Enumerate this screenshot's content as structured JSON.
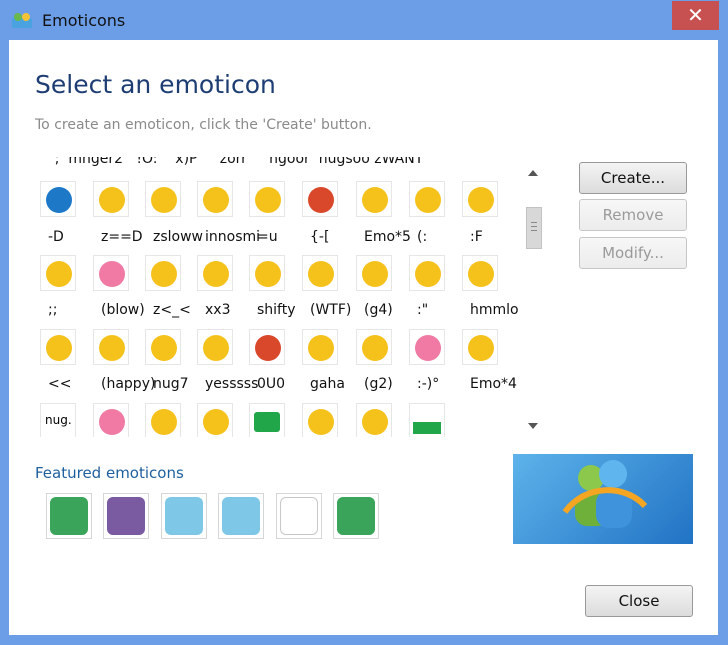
{
  "window": {
    "title": "Emoticons",
    "close_glyph": "✕"
  },
  "header": {
    "heading": "Select an emoticon",
    "subtext": "To create an emoticon, click the 'Create' button."
  },
  "grid": {
    "top_partial_labels": "'  ;  mnger2   !O:    x)P     zorr     ngoor  nugsoo zWANT",
    "rows": [
      {
        "labels": [
          "-D",
          "z==D",
          "zsloww",
          "innosmi",
          "=u",
          "{-[",
          "Emo*5",
          "(:",
          ":F"
        ]
      },
      {
        "labels": [
          ";;",
          "(blow)",
          "z<_<",
          "xx3",
          "shifty",
          "(WTF)",
          "(g4)",
          ":\"",
          "hmmlol"
        ]
      },
      {
        "labels": [
          "<<",
          "(happy)",
          "nug7",
          "yesssss",
          "0U0",
          "gaha",
          "(g2)",
          ":-)°",
          "Emo*4"
        ]
      }
    ],
    "icon_rows": [
      [
        "blue-face-icon",
        "sweat-face-icon",
        "dizzy-face-icon",
        "smile-face-icon",
        "surprise-face-icon",
        "angry-face-icon",
        "dancing-face-icon",
        "cute-face-icon",
        "meh-face-icon"
      ],
      [
        "wink-face-icon",
        "pink-hair-icon",
        "sleepy-face-icon",
        "crazy-face-icon",
        "plain-face-icon",
        "snails-icon",
        "spark-face-icon",
        "drool-face-icon",
        "lol-face-icon"
      ],
      [
        "side-eye-face-icon",
        "girl-face-icon",
        "sneaky-face-icon",
        "grin-face-icon",
        "fire-face-icon",
        "shock-face-icon",
        "sleep-bed-icon",
        "blush-face-icon",
        "dance2-face-icon"
      ],
      [
        "nug-text-icon",
        "pig-face-icon",
        "running-face-icon",
        "star-face-icon",
        "radio-icon",
        "sign-face-icon",
        "roll-face-icon",
        "battery-icon"
      ]
    ],
    "nug_text": "nug.",
    "colors": {
      "yellow": "#f5c11b",
      "blue": "#1e78c8",
      "pink": "#f07aa3",
      "green": "#22a64a",
      "red": "#d9482b"
    }
  },
  "buttons": {
    "create": "Create...",
    "remove": "Remove",
    "modify": "Modify...",
    "close": "Close"
  },
  "featured": {
    "label": "Featured emoticons",
    "items": [
      "green-monster-icon",
      "purple-creature-icon",
      "flower-icon",
      "flower-icon",
      "blank-icon",
      "green-monster-icon"
    ]
  },
  "branding": {
    "logo": "messenger-people-icon"
  }
}
